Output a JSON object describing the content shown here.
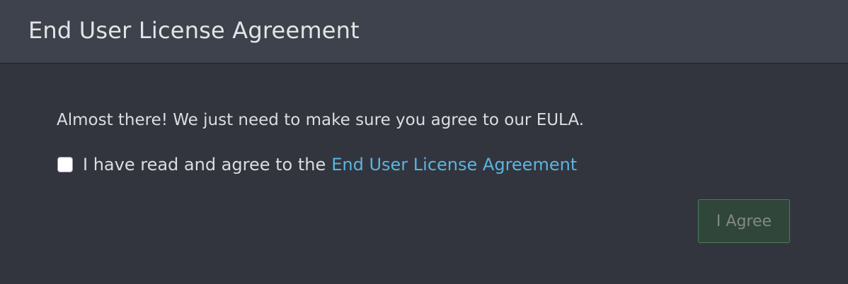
{
  "dialog": {
    "title": "End User License Agreement",
    "intro": "Almost there! We just need to make sure you agree to our EULA.",
    "agreement": {
      "label": "I have read and agree to the",
      "link_text": "End User License Agreement",
      "checked": false
    },
    "agree_button": {
      "label": "I Agree",
      "disabled": true
    }
  },
  "colors": {
    "background": "#32353d",
    "header_background": "#3e424c",
    "link": "#5ab4e2",
    "button_background": "#31463a",
    "button_border": "#4f7a5a"
  }
}
